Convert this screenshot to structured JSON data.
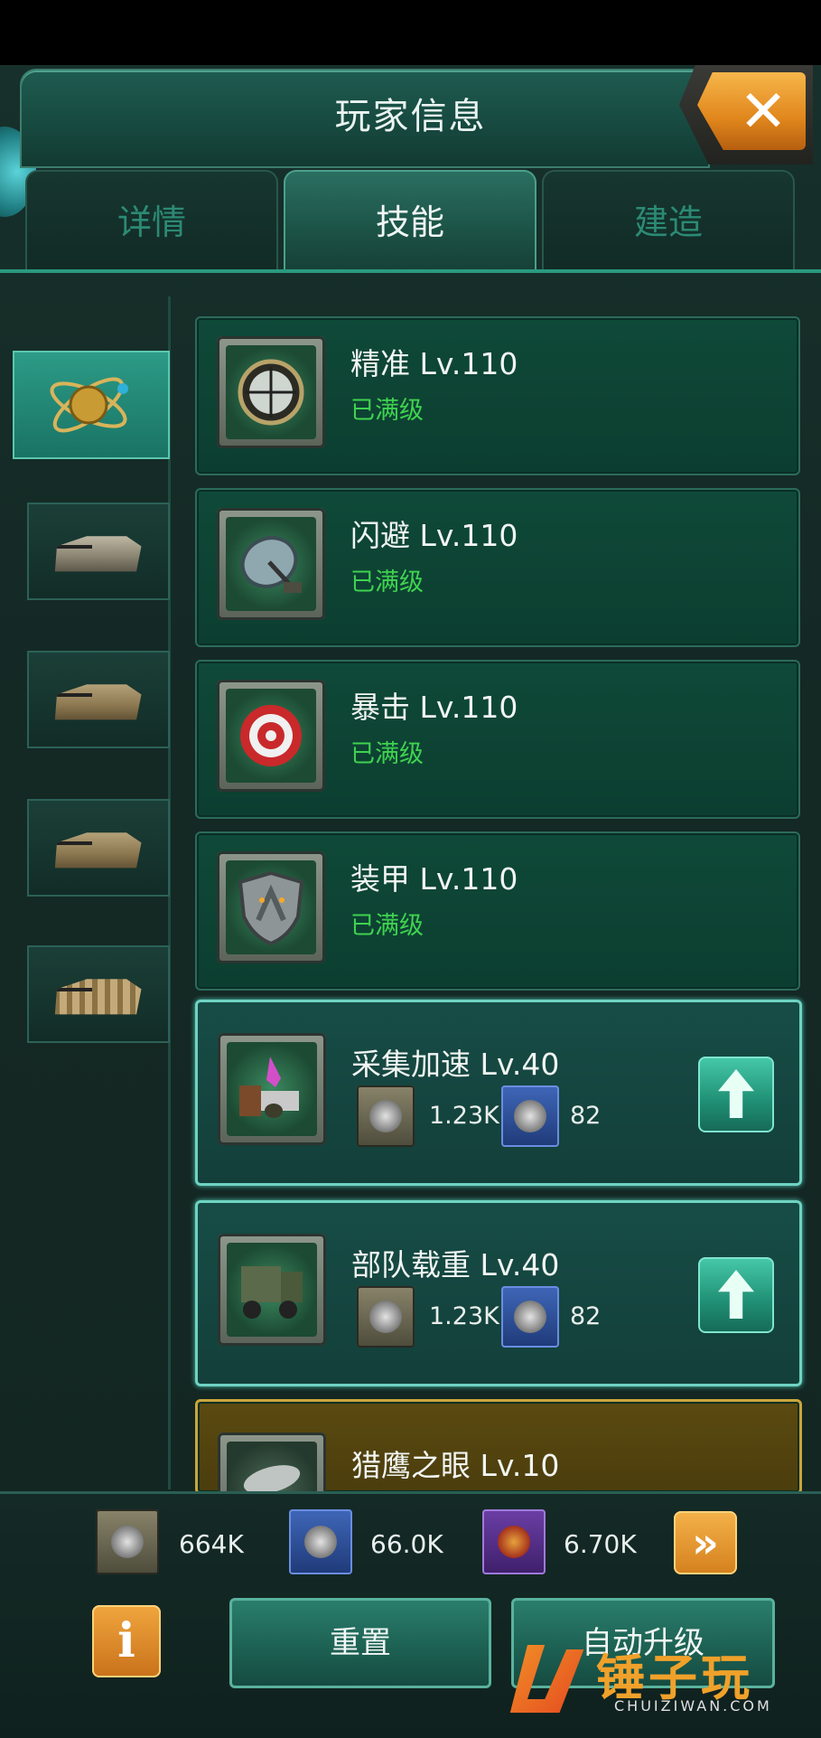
{
  "header": {
    "title": "玩家信息",
    "close_icon": "close-icon"
  },
  "tabs": [
    {
      "label": "详情",
      "active": false
    },
    {
      "label": "技能",
      "active": true
    },
    {
      "label": "建造",
      "active": false
    }
  ],
  "side_categories": [
    {
      "icon": "atom-globe-icon",
      "active": true
    },
    {
      "icon": "tank-icon",
      "active": false
    },
    {
      "icon": "camo-tank-icon",
      "active": false
    },
    {
      "icon": "artillery-icon",
      "active": false
    },
    {
      "icon": "rocket-launcher-icon",
      "active": false
    }
  ],
  "skills": [
    {
      "name": "精准 Lv.110",
      "status": "已满级",
      "icon": "crosshair-icon"
    },
    {
      "name": "闪避 Lv.110",
      "status": "已满级",
      "icon": "radar-icon"
    },
    {
      "name": "暴击 Lv.110",
      "status": "已满级",
      "icon": "target-icon"
    },
    {
      "name": "装甲 Lv.110",
      "status": "已满级",
      "icon": "armor-shield-icon"
    },
    {
      "name": "采集加速 Lv.40",
      "cost1": "1.23K",
      "cost2": "82",
      "icon": "resources-icon"
    },
    {
      "name": "部队载重 Lv.40",
      "cost1": "1.23K",
      "cost2": "82",
      "icon": "truck-icon"
    },
    {
      "name": "猎鹰之眼 Lv.10",
      "icon": "satellite-dish-icon"
    }
  ],
  "resources": [
    {
      "icon": "medal-skull-icon",
      "value": "664K"
    },
    {
      "icon": "medal-helmet-icon",
      "value": "66.0K"
    },
    {
      "icon": "medal-cross-icon",
      "value": "6.70K"
    }
  ],
  "buttons": {
    "reset": "重置",
    "auto_upgrade": "自动升级"
  },
  "watermark": {
    "text": "锤子玩",
    "sub": "CHUIZIWAN.COM"
  },
  "colors": {
    "accent_green": "#3fd24f",
    "teal": "#2a9a7f",
    "orange": "#f0a63e"
  }
}
